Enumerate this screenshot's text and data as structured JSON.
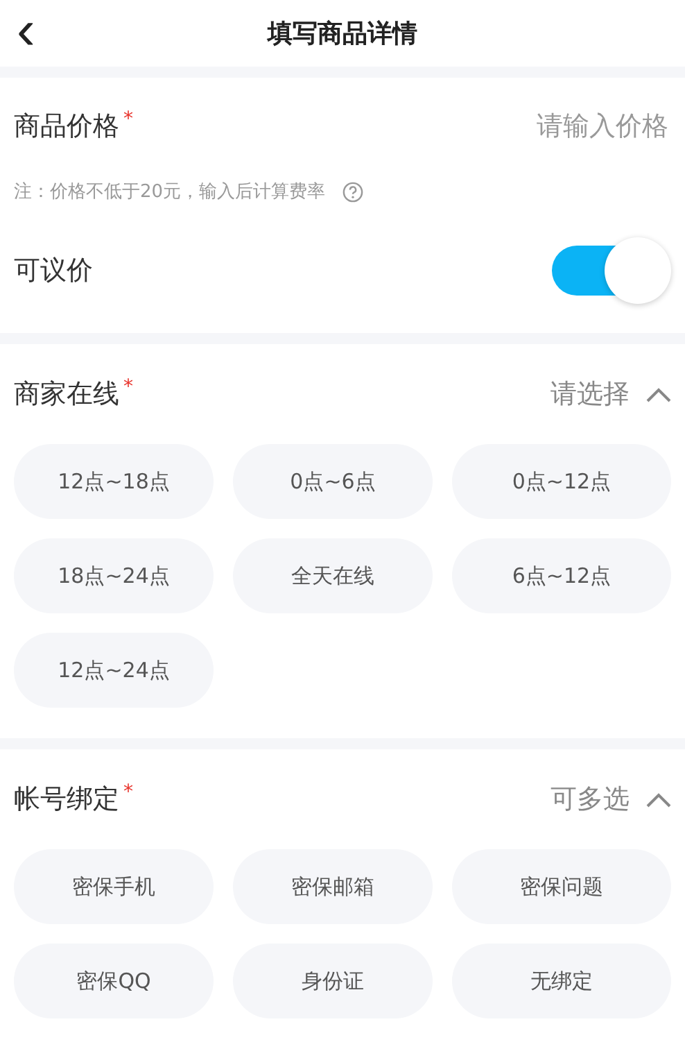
{
  "header": {
    "back_icon": "‹",
    "title": "填写商品详情"
  },
  "price": {
    "label": "商品价格",
    "required_mark": "*",
    "placeholder": "请输入价格",
    "note": "注：价格不低于20元，输入后计算费率",
    "negotiable": {
      "label": "可议价",
      "on": true
    }
  },
  "sections": [
    {
      "label": "商家在线",
      "required_mark": "*",
      "hint": "请选择",
      "expanded": true,
      "options": [
        {
          "label": "12点~18点",
          "selected": false
        },
        {
          "label": "0点~6点",
          "selected": false
        },
        {
          "label": "0点~12点",
          "selected": false
        },
        {
          "label": "18点~24点",
          "selected": false
        },
        {
          "label": "全天在线",
          "selected": false
        },
        {
          "label": "6点~12点",
          "selected": false
        },
        {
          "label": "12点~24点",
          "selected": false
        }
      ]
    },
    {
      "label": "帐号绑定",
      "required_mark": "*",
      "hint": "可多选",
      "expanded": true,
      "options": [
        {
          "label": "密保手机",
          "selected": false
        },
        {
          "label": "密保邮箱",
          "selected": false
        },
        {
          "label": "密保问题",
          "selected": false
        },
        {
          "label": "密保QQ",
          "selected": false
        },
        {
          "label": "身份证",
          "selected": false
        },
        {
          "label": "无绑定",
          "selected": false
        }
      ]
    }
  ]
}
